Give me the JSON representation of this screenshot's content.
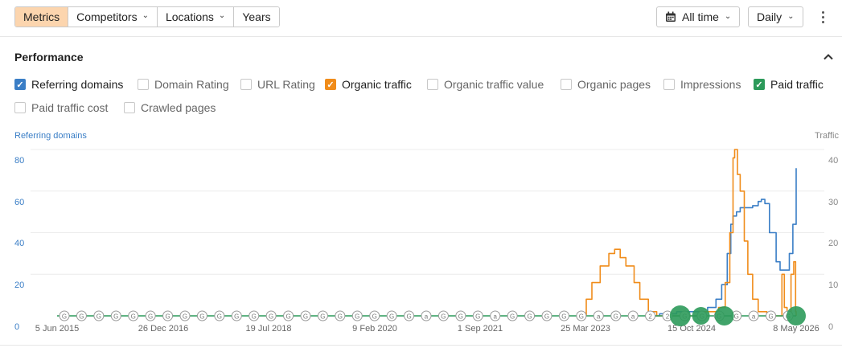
{
  "toolbar": {
    "tabs": [
      {
        "label": "Metrics",
        "active": true,
        "dropdown": false
      },
      {
        "label": "Competitors",
        "active": false,
        "dropdown": true
      },
      {
        "label": "Locations",
        "active": false,
        "dropdown": true
      },
      {
        "label": "Years",
        "active": false,
        "dropdown": false
      }
    ],
    "range_label": "All time",
    "interval_label": "Daily"
  },
  "section": {
    "title": "Performance"
  },
  "metrics": [
    {
      "label": "Referring domains",
      "checked": true,
      "color": "#3a7ec6"
    },
    {
      "label": "Domain Rating",
      "checked": false,
      "color": ""
    },
    {
      "label": "URL Rating",
      "checked": false,
      "color": ""
    },
    {
      "label": "Organic traffic",
      "checked": true,
      "color": "#f08c1a"
    },
    {
      "label": "Organic traffic value",
      "checked": false,
      "color": ""
    },
    {
      "label": "Organic pages",
      "checked": false,
      "color": ""
    },
    {
      "label": "Impressions",
      "checked": false,
      "color": ""
    },
    {
      "label": "Paid traffic",
      "checked": true,
      "color": "#2c9a5a"
    },
    {
      "label": "Paid traffic cost",
      "checked": false,
      "color": ""
    },
    {
      "label": "Crawled pages",
      "checked": false,
      "color": ""
    }
  ],
  "chart_data": {
    "type": "line",
    "left_axis_label": "Referring domains",
    "right_axis_label": "Traffic",
    "left_ticks": [
      "0",
      "20",
      "40",
      "60",
      "80"
    ],
    "right_ticks": [
      "0",
      "10",
      "20",
      "30",
      "40"
    ],
    "x_ticks": [
      "5 Jun 2015",
      "26 Dec 2016",
      "19 Jul 2018",
      "9 Feb 2020",
      "1 Sep 2021",
      "25 Mar 2023",
      "15 Oct 2024",
      "8 May 2026"
    ],
    "x_range": [
      "2015-06-05",
      "2026-05-08"
    ],
    "left_ylim": [
      0,
      80
    ],
    "right_ylim": [
      0,
      40
    ],
    "series": [
      {
        "name": "Referring domains",
        "axis": "left",
        "color": "#3a7ec6",
        "points": [
          [
            "2024-03-01",
            0
          ],
          [
            "2024-05-01",
            1
          ],
          [
            "2024-08-01",
            2
          ],
          [
            "2024-11-01",
            2
          ],
          [
            "2025-01-15",
            4
          ],
          [
            "2025-03-01",
            8
          ],
          [
            "2025-04-01",
            15
          ],
          [
            "2025-05-01",
            30
          ],
          [
            "2025-05-20",
            44
          ],
          [
            "2025-06-01",
            48
          ],
          [
            "2025-06-20",
            50
          ],
          [
            "2025-07-10",
            52
          ],
          [
            "2025-08-15",
            52
          ],
          [
            "2025-09-15",
            53
          ],
          [
            "2025-10-15",
            55
          ],
          [
            "2025-11-01",
            56
          ],
          [
            "2025-11-20",
            54
          ],
          [
            "2025-12-15",
            40
          ],
          [
            "2026-01-20",
            26
          ],
          [
            "2026-02-10",
            22
          ],
          [
            "2026-03-01",
            22
          ],
          [
            "2026-04-01",
            30
          ],
          [
            "2026-04-20",
            44
          ],
          [
            "2026-05-08",
            71
          ]
        ]
      },
      {
        "name": "Organic traffic",
        "axis": "right",
        "color": "#f08c1a",
        "points": [
          [
            "2023-02-15",
            0
          ],
          [
            "2023-04-01",
            4
          ],
          [
            "2023-05-01",
            8
          ],
          [
            "2023-06-15",
            12
          ],
          [
            "2023-08-01",
            15
          ],
          [
            "2023-09-01",
            16
          ],
          [
            "2023-10-01",
            14
          ],
          [
            "2023-11-01",
            12
          ],
          [
            "2023-12-15",
            8
          ],
          [
            "2024-01-15",
            4
          ],
          [
            "2024-03-01",
            1
          ],
          [
            "2024-04-15",
            0
          ],
          [
            "2024-09-01",
            0
          ],
          [
            "2024-12-01",
            1
          ],
          [
            "2025-02-01",
            1
          ],
          [
            "2025-03-15",
            2
          ],
          [
            "2025-04-20",
            8
          ],
          [
            "2025-05-15",
            20
          ],
          [
            "2025-06-01",
            38
          ],
          [
            "2025-06-10",
            40
          ],
          [
            "2025-06-25",
            34
          ],
          [
            "2025-07-10",
            30
          ],
          [
            "2025-08-01",
            18
          ],
          [
            "2025-08-20",
            10
          ],
          [
            "2025-09-15",
            4
          ],
          [
            "2025-10-15",
            1
          ],
          [
            "2025-12-01",
            0
          ],
          [
            "2026-02-01",
            0
          ],
          [
            "2026-02-20",
            10
          ],
          [
            "2026-03-05",
            2
          ],
          [
            "2026-03-20",
            0
          ],
          [
            "2026-04-10",
            10
          ],
          [
            "2026-04-25",
            13
          ],
          [
            "2026-05-05",
            1
          ],
          [
            "2026-05-08",
            0
          ]
        ]
      },
      {
        "name": "Paid traffic",
        "axis": "right",
        "color": "#2c9a5a",
        "points": [
          [
            "2015-06-05",
            0
          ],
          [
            "2026-05-08",
            0
          ]
        ]
      }
    ]
  },
  "annotations": {
    "glyphs": [
      "G",
      "G",
      "G",
      "G",
      "G",
      "G",
      "G",
      "G",
      "G",
      "G",
      "G",
      "G",
      "G",
      "G",
      "G",
      "G",
      "G",
      "G",
      "G",
      "G",
      "G",
      "a",
      "G",
      "G",
      "G",
      "a",
      "G",
      "G",
      "G",
      "G",
      "G",
      "a",
      "G",
      "a",
      "2",
      "2",
      "G",
      "G",
      "G",
      "G",
      "a",
      "G",
      "G"
    ]
  }
}
